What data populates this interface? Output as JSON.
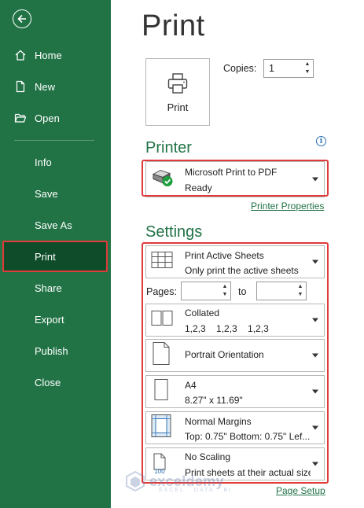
{
  "sidebar": {
    "items": [
      {
        "label": "Home"
      },
      {
        "label": "New"
      },
      {
        "label": "Open"
      },
      {
        "label": "Info"
      },
      {
        "label": "Save"
      },
      {
        "label": "Save As"
      },
      {
        "label": "Print"
      },
      {
        "label": "Share"
      },
      {
        "label": "Export"
      },
      {
        "label": "Publish"
      },
      {
        "label": "Close"
      }
    ],
    "active": "Print",
    "bg_color": "#217346"
  },
  "main": {
    "title": "Print",
    "print_button_label": "Print",
    "copies": {
      "label": "Copies:",
      "value": "1"
    },
    "printer": {
      "heading": "Printer",
      "name": "Microsoft Print to PDF",
      "status": "Ready",
      "properties_link": "Printer Properties"
    },
    "settings": {
      "heading": "Settings",
      "sheets": {
        "title": "Print Active Sheets",
        "sub": "Only print the active sheets"
      },
      "pages": {
        "label": "Pages:",
        "to_label": "to",
        "from": "",
        "to": ""
      },
      "collation": {
        "title": "Collated",
        "sub": "1,2,3    1,2,3    1,2,3"
      },
      "orientation": {
        "title": "Portrait Orientation"
      },
      "paper": {
        "title": "A4",
        "sub": "8.27\" x 11.69\""
      },
      "margins": {
        "title": "Normal Margins",
        "sub": "Top: 0.75\" Bottom: 0.75\" Lef..."
      },
      "scaling": {
        "title": "No Scaling",
        "sub": "Print sheets at their actual size",
        "icon_text": "100"
      },
      "page_setup_link": "Page Setup"
    }
  },
  "watermark": {
    "text": "exceldemy",
    "sub": "EXCEL · DATA · BI"
  },
  "colors": {
    "accent": "#217346",
    "highlight": "#e03a3a",
    "active_bg": "#0f4d2a"
  }
}
